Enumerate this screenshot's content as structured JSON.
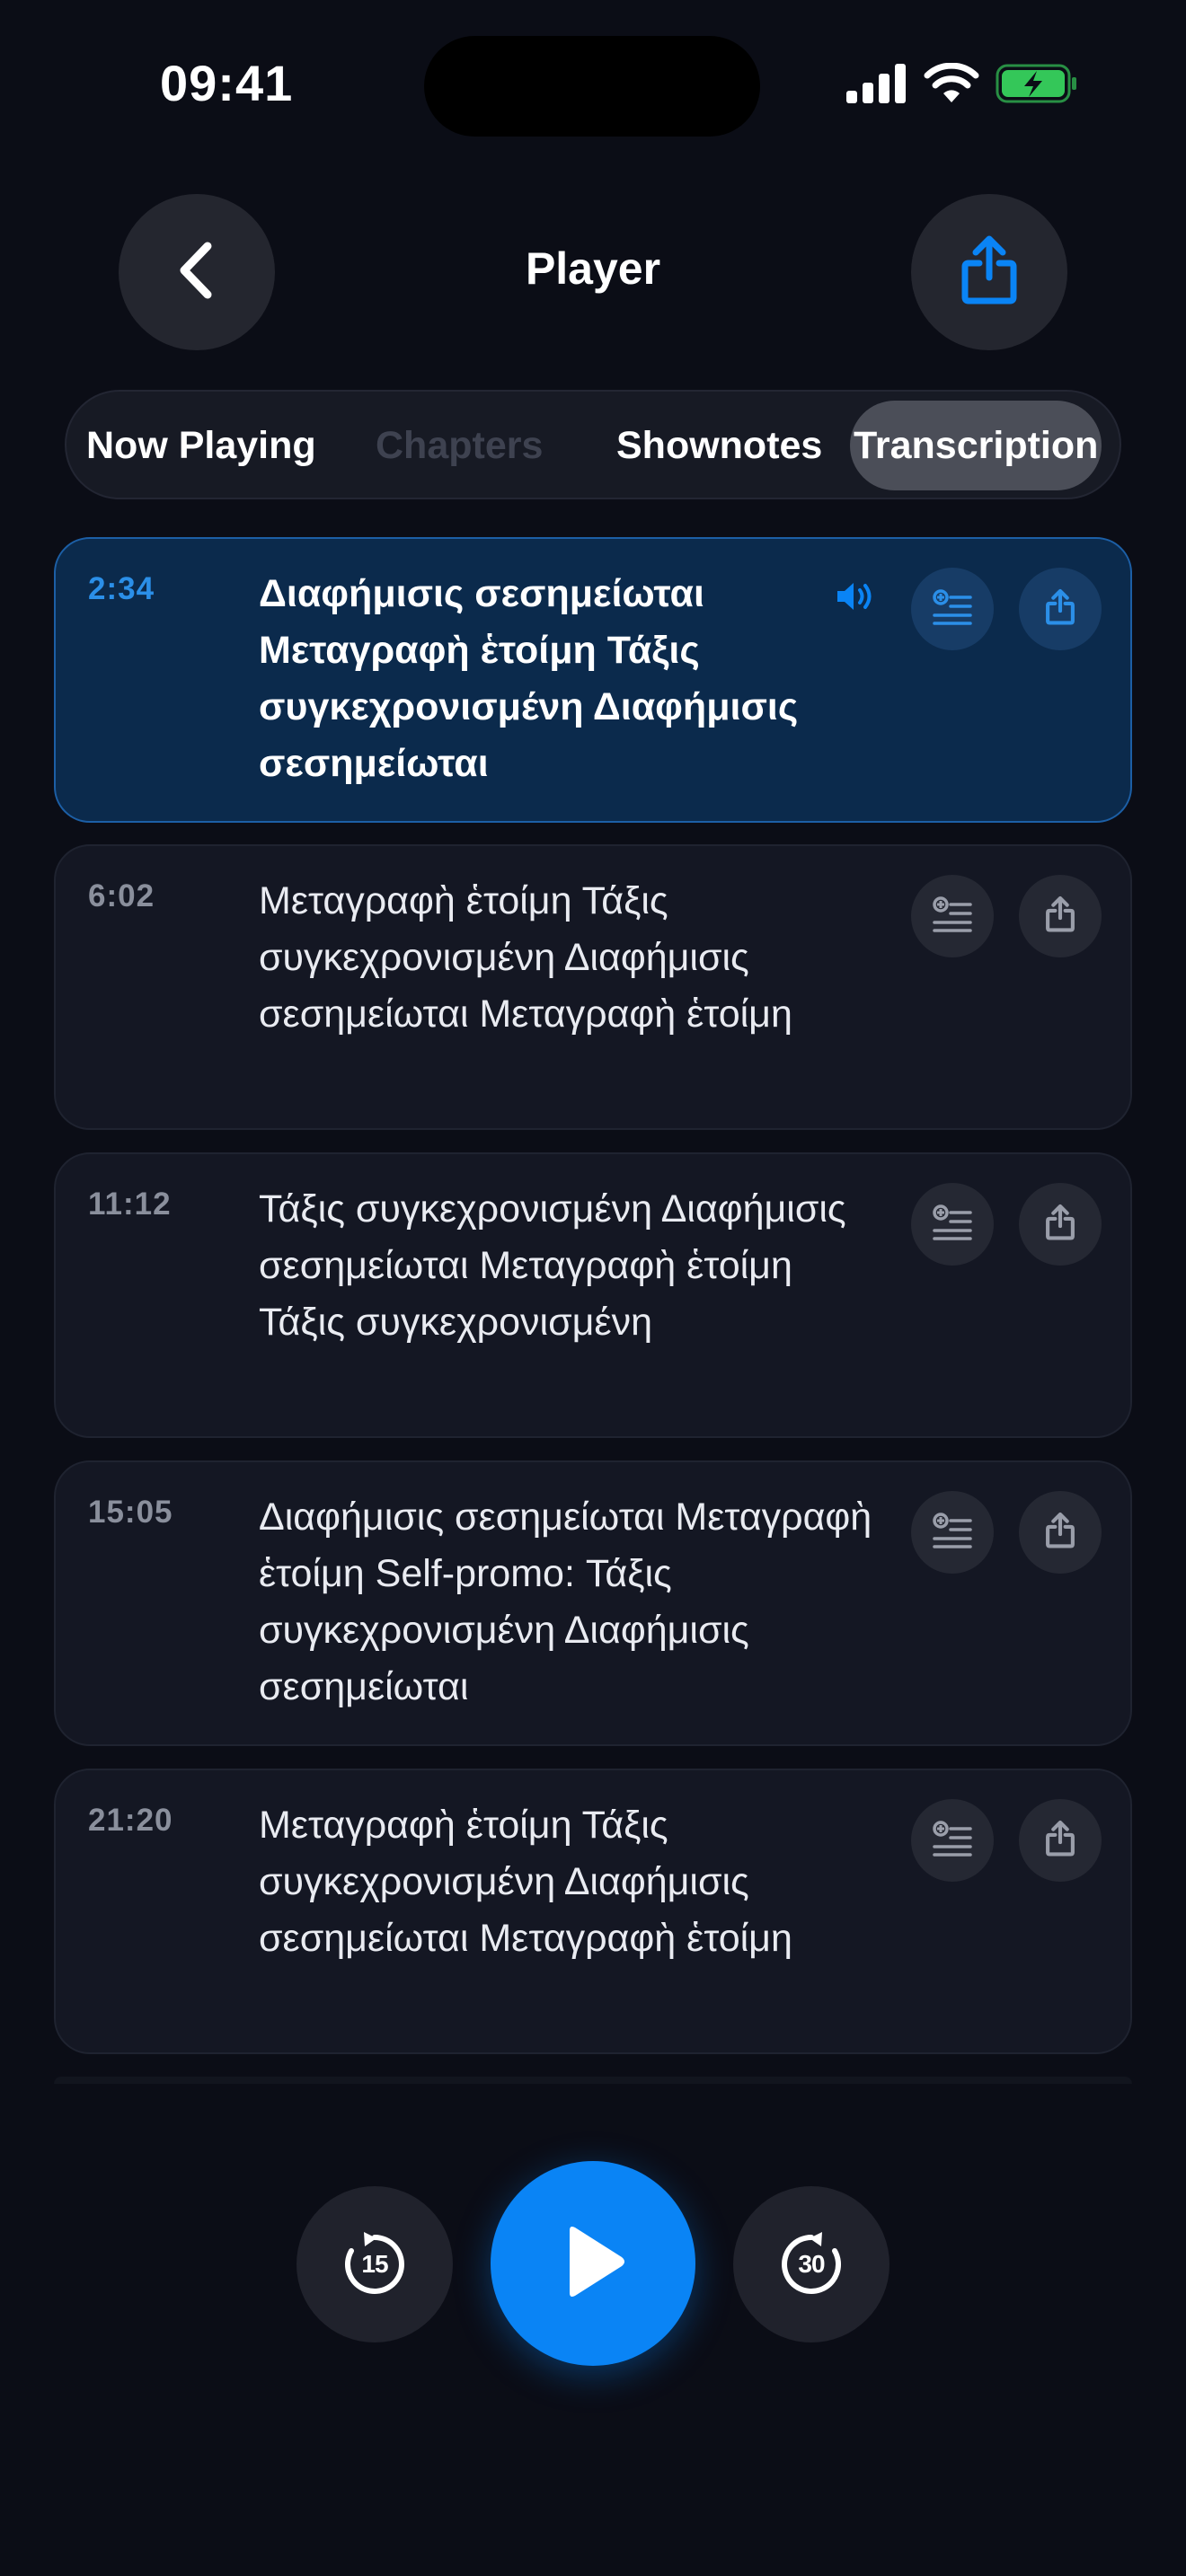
{
  "status_bar": {
    "time": "09:41"
  },
  "header": {
    "title": "Player"
  },
  "tabs": [
    {
      "label": "Now Playing",
      "state": "normal"
    },
    {
      "label": "Chapters",
      "state": "disabled"
    },
    {
      "label": "Shownotes",
      "state": "normal"
    },
    {
      "label": "Transcription",
      "state": "selected"
    }
  ],
  "segments": [
    {
      "time": "2:34",
      "text": "Διαφήμισις σεσημείωται Μεταγραφὴ ἑτοίμη Τάξις συγκεχρονισμένη Διαφήμισις σεσημείωται",
      "active": true
    },
    {
      "time": "6:02",
      "text": "Μεταγραφὴ ἑτοίμη Τάξις συγκεχρονισμένη Διαφήμισις σεσημείωται Μεταγραφὴ ἑτοίμη",
      "active": false
    },
    {
      "time": "11:12",
      "text": "Τάξις συγκεχρονισμένη Διαφήμισις σεσημείωται Μεταγραφὴ ἑτοίμη Τάξις συγκεχρονισμένη",
      "active": false
    },
    {
      "time": "15:05",
      "text": "Διαφήμισις σεσημείωται Μεταγραφὴ ἑτοίμη Self-promo: Τάξις συγκεχρονισμένη Διαφήμισις σεσημείωται",
      "active": false
    },
    {
      "time": "21:20",
      "text": "Μεταγραφὴ ἑτοίμη Τάξις συγκεχρονισμένη Διαφήμισις σεσημείωται Μεταγραφὴ ἑτοίμη",
      "active": false
    }
  ],
  "controls": {
    "skip_back": "15",
    "skip_forward": "30"
  },
  "colors": {
    "accent": "#0a84f5",
    "background": "#0b0d16",
    "battery": "#34c759"
  }
}
